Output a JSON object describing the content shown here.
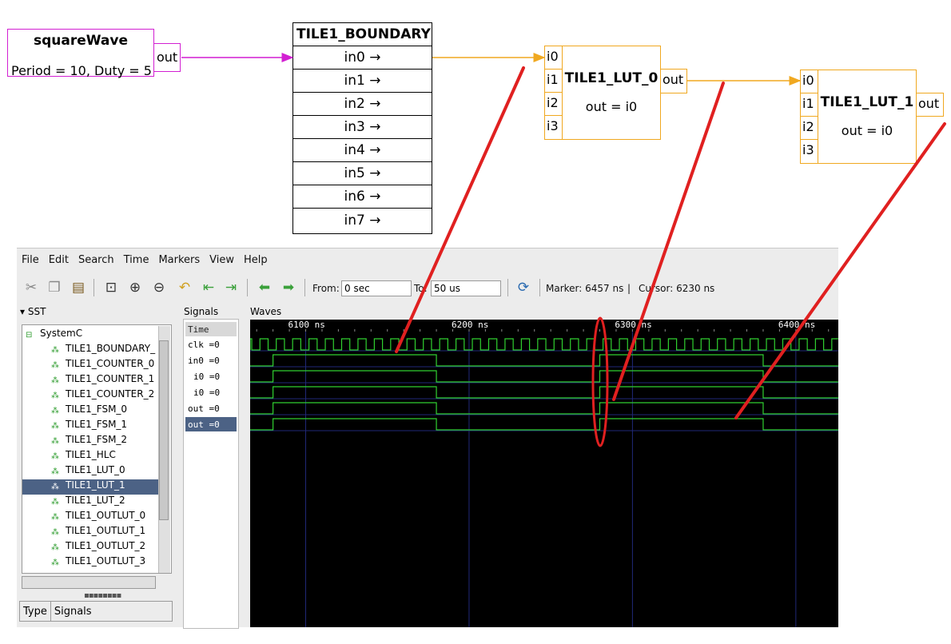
{
  "diagram": {
    "square_wave": {
      "title": "squareWave",
      "params": "Period = 10, Duty = 5",
      "port": "out"
    },
    "boundary": {
      "title": "TILE1_BOUNDARY",
      "ports": [
        "in0 →",
        "in1 →",
        "in2 →",
        "in3 →",
        "in4 →",
        "in5 →",
        "in6 →",
        "in7 →"
      ]
    },
    "lut0": {
      "name": "TILE1_LUT_0",
      "eq": "out = i0",
      "inputs": [
        "i0",
        "i1",
        "i2",
        "i3"
      ],
      "output": "out"
    },
    "lut1": {
      "name": "TILE1_LUT_1",
      "eq": "out = i0",
      "inputs": [
        "i0",
        "i1",
        "i2",
        "i3"
      ],
      "output": "out"
    },
    "colors": {
      "square_wave": "#d21fd2",
      "lut": "#f0a820",
      "annotation": "#e02020"
    }
  },
  "gtkwave": {
    "menu": [
      "File",
      "Edit",
      "Search",
      "Time",
      "Markers",
      "View",
      "Help"
    ],
    "toolbar": {
      "icons": [
        "cut-icon",
        "copy-icon",
        "paste-icon",
        "zoom-fit-icon",
        "zoom-in-icon",
        "zoom-out-icon",
        "undo-icon",
        "go-start-icon",
        "go-end-icon",
        "back-icon",
        "forward-icon",
        "reload-icon"
      ],
      "from_label": "From:",
      "from_value": "0 sec",
      "to_label": "To:",
      "to_value": "50 us",
      "marker": "Marker: 6457 ns",
      "sep": "|",
      "cursor": "Cursor: 6230 ns"
    },
    "sst": {
      "header": "SST",
      "root": "SystemC",
      "items": [
        "TILE1_BOUNDARY_",
        "TILE1_COUNTER_0",
        "TILE1_COUNTER_1",
        "TILE1_COUNTER_2",
        "TILE1_FSM_0",
        "TILE1_FSM_1",
        "TILE1_FSM_2",
        "TILE1_HLC",
        "TILE1_LUT_0",
        "TILE1_LUT_1",
        "TILE1_LUT_2",
        "TILE1_OUTLUT_0",
        "TILE1_OUTLUT_1",
        "TILE1_OUTLUT_2",
        "TILE1_OUTLUT_3"
      ],
      "selected_index": 9,
      "type_label": "Type",
      "signals_label": "Signals"
    },
    "signals": {
      "header": "Signals",
      "time_label": "Time",
      "rows": [
        "clk =0",
        "in0 =0",
        "i0 =0",
        "i0 =0",
        "out =0",
        "out =0"
      ],
      "selected_index": 5
    },
    "waves": {
      "header": "Waves",
      "time_labels": [
        "6100 ns",
        "6200 ns",
        "6300 ns",
        "6400 ns"
      ],
      "time_label_values_ns": [
        6100,
        6200,
        6300,
        6400
      ],
      "view_start_ns": 6066,
      "view_end_ns": 6426,
      "clk_period_ns": 10,
      "transitions_ns": [
        6080,
        6180,
        6280,
        6380
      ],
      "highlight_ns": 6280,
      "colors": {
        "wave": "#30d030",
        "grid": "#202878",
        "text": "#ffffff"
      }
    }
  }
}
